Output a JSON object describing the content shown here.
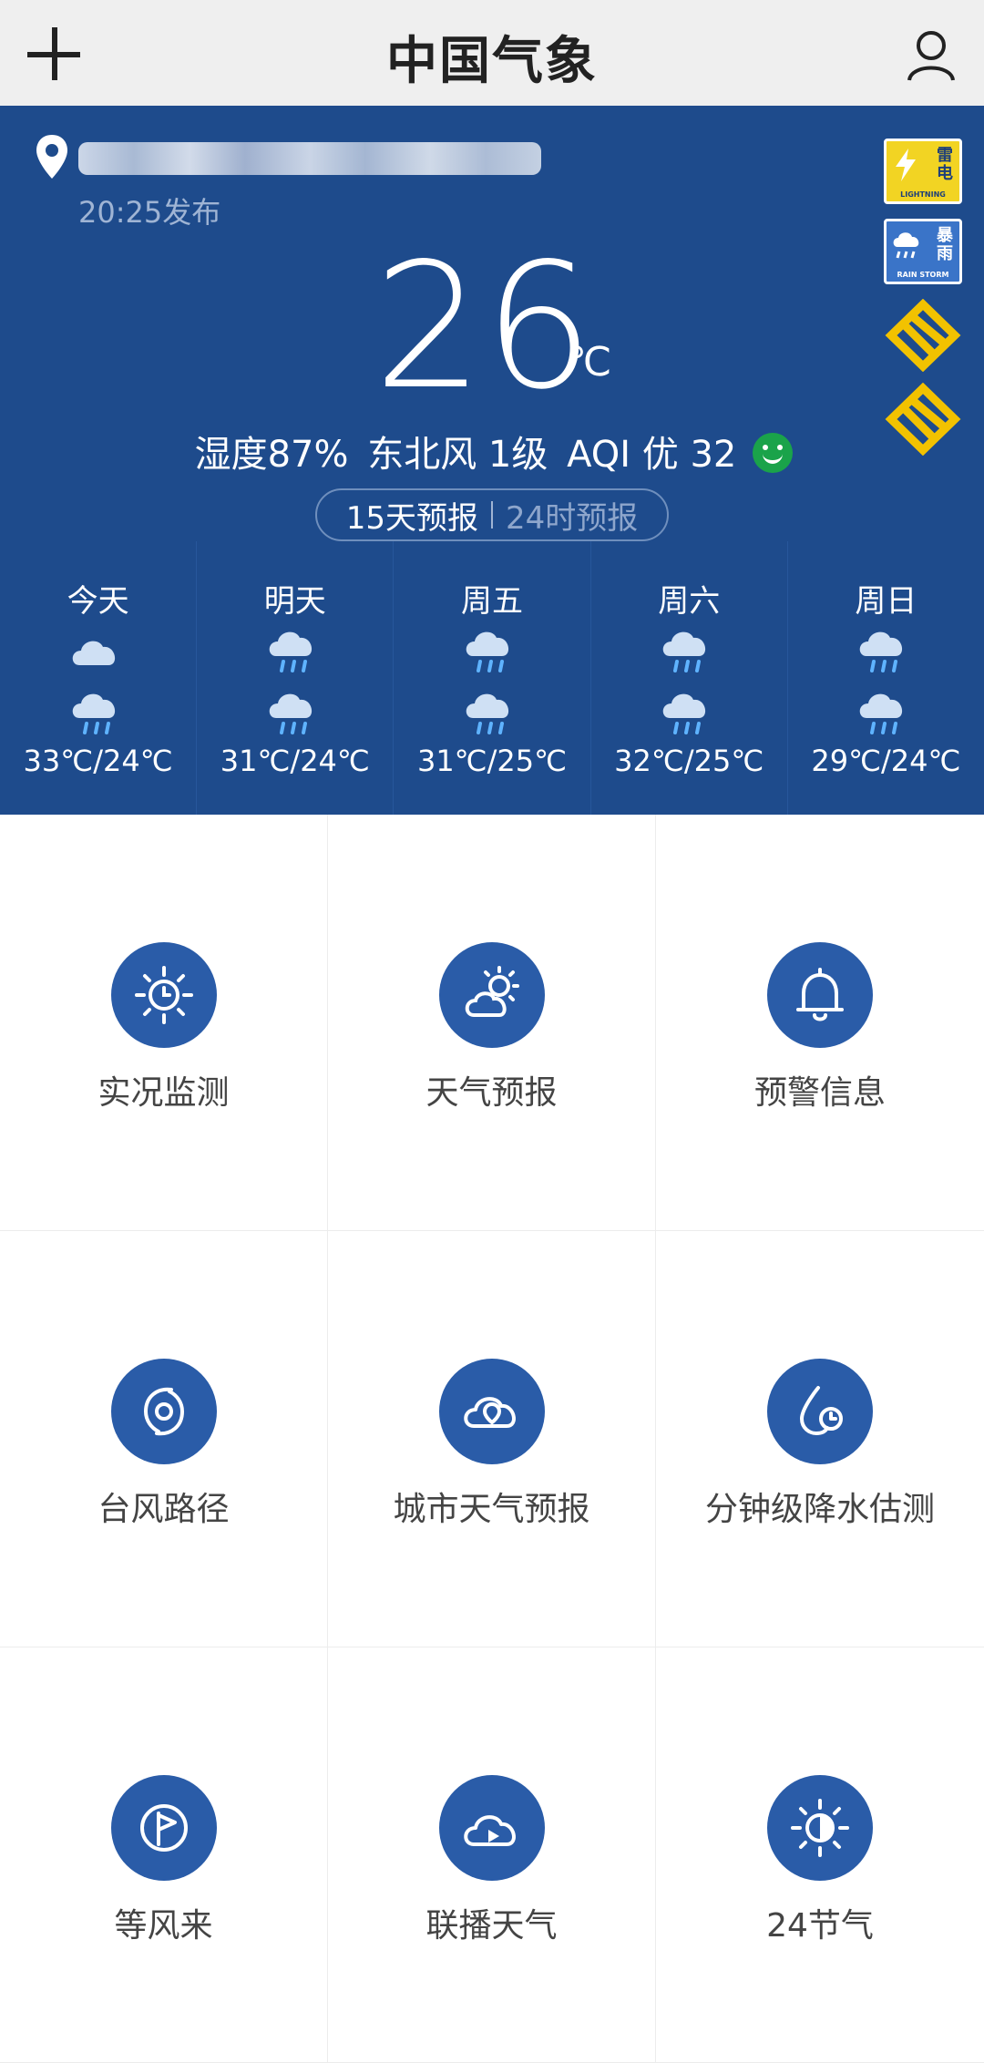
{
  "header": {
    "brand": "中国气象"
  },
  "weather": {
    "publish_time": "20:25发布",
    "temperature": "26",
    "unit": "℃",
    "humidity": "湿度87%",
    "wind": "东北风 1级",
    "aqi": "AQI 优 32",
    "tabs": {
      "active": "15天预报",
      "inactive": "24时预报"
    },
    "badges": [
      {
        "kind": "lightning",
        "cn": "雷电",
        "en": "LIGHTNING",
        "color": "#f2d423"
      },
      {
        "kind": "storm",
        "cn": "暴雨",
        "en": "RAIN STORM",
        "color": "#3a74c8"
      }
    ],
    "days": [
      {
        "name": "今天",
        "icon_day": "cloudy-icon",
        "icon_night": "rain-icon",
        "range": "33℃/24℃"
      },
      {
        "name": "明天",
        "icon_day": "rain-icon",
        "icon_night": "rain-icon",
        "range": "31℃/24℃"
      },
      {
        "name": "周五",
        "icon_day": "rain-icon",
        "icon_night": "rain-icon",
        "range": "31℃/25℃"
      },
      {
        "name": "周六",
        "icon_day": "rain-icon",
        "icon_night": "rain-icon",
        "range": "32℃/25℃"
      },
      {
        "name": "周日",
        "icon_day": "rain-icon",
        "icon_night": "rain-icon",
        "range": "29℃/24℃"
      }
    ]
  },
  "functions": [
    {
      "label": "实况监测",
      "icon": "sun-clock-icon"
    },
    {
      "label": "天气预报",
      "icon": "sun-cloud-icon"
    },
    {
      "label": "预警信息",
      "icon": "bell-icon"
    },
    {
      "label": "台风路径",
      "icon": "typhoon-icon"
    },
    {
      "label": "城市天气预报",
      "icon": "cloud-location-icon"
    },
    {
      "label": "分钟级降水估测",
      "icon": "drop-clock-icon"
    },
    {
      "label": "等风来",
      "icon": "flag-icon"
    },
    {
      "label": "联播天气",
      "icon": "cloud-play-icon"
    },
    {
      "label": "24节气",
      "icon": "half-sun-icon"
    }
  ],
  "colors": {
    "panel_bg": "#1e4b8c",
    "icon_circle": "#2a5ca8",
    "aqi_good": "#1aa34a"
  }
}
